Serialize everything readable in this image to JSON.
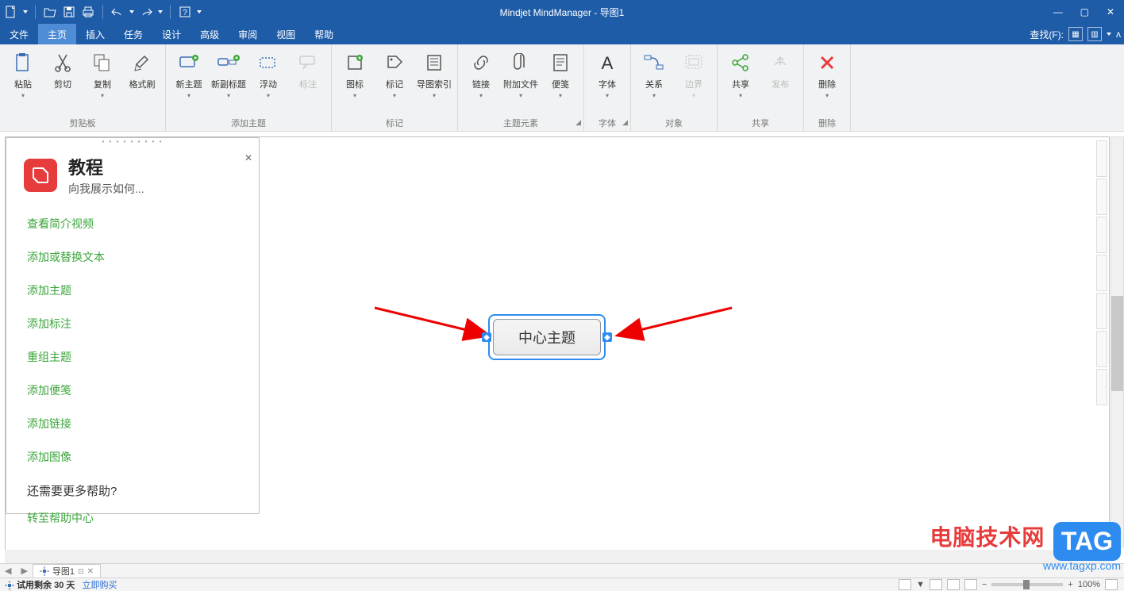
{
  "app": {
    "title": "Mindjet MindManager - 导图1"
  },
  "qat_icons": [
    "new",
    "open",
    "save",
    "print",
    "undo",
    "redo",
    "help"
  ],
  "menu": {
    "tabs": [
      "文件",
      "主页",
      "插入",
      "任务",
      "设计",
      "高级",
      "审阅",
      "视图",
      "帮助"
    ],
    "active": 1,
    "find_label": "查找(F):"
  },
  "ribbon": {
    "groups": [
      {
        "name": "剪贴板",
        "items": [
          {
            "id": "paste",
            "label": "粘贴",
            "dd": true
          },
          {
            "id": "cut",
            "label": "剪切"
          },
          {
            "id": "copy",
            "label": "复制",
            "dd": true
          },
          {
            "id": "format",
            "label": "格式刷"
          }
        ]
      },
      {
        "name": "添加主题",
        "items": [
          {
            "id": "new-topic",
            "label": "新主题",
            "dd": true
          },
          {
            "id": "new-subtopic",
            "label": "新副标题",
            "dd": true
          },
          {
            "id": "float",
            "label": "浮动",
            "dd": true
          },
          {
            "id": "callout",
            "label": "标注",
            "disabled": true
          }
        ]
      },
      {
        "name": "标记",
        "items": [
          {
            "id": "icon",
            "label": "图标",
            "dd": true
          },
          {
            "id": "tag",
            "label": "标记",
            "dd": true
          },
          {
            "id": "index",
            "label": "导图索引",
            "dd": true
          }
        ]
      },
      {
        "name": "主题元素",
        "launcher": true,
        "items": [
          {
            "id": "link",
            "label": "链接",
            "dd": true
          },
          {
            "id": "attach",
            "label": "附加文件",
            "dd": true
          },
          {
            "id": "note",
            "label": "便笺",
            "dd": true
          }
        ]
      },
      {
        "name": "字体",
        "launcher": true,
        "items": [
          {
            "id": "font",
            "label": "字体",
            "dd": true
          }
        ]
      },
      {
        "name": "对象",
        "items": [
          {
            "id": "relation",
            "label": "关系",
            "dd": true
          },
          {
            "id": "border",
            "label": "边界",
            "disabled": true,
            "dd": true
          }
        ]
      },
      {
        "name": "共享",
        "items": [
          {
            "id": "share",
            "label": "共享",
            "dd": true
          },
          {
            "id": "publish",
            "label": "发布",
            "disabled": true
          }
        ]
      },
      {
        "name": "删除",
        "items": [
          {
            "id": "delete",
            "label": "删除",
            "dd": true
          }
        ]
      }
    ]
  },
  "tutorial": {
    "title": "教程",
    "subtitle": "向我展示如何...",
    "links": [
      "查看简介视频",
      "添加或替换文本",
      "添加主题",
      "添加标注",
      "重组主题",
      "添加便笺",
      "添加链接",
      "添加图像"
    ],
    "more_q": "还需要更多帮助?",
    "help_center": "转至帮助中心"
  },
  "canvas": {
    "central_topic": "中心主题"
  },
  "doctab": {
    "name": "导图1"
  },
  "status": {
    "trial": "试用剩余 30 天",
    "buy": "立即购买",
    "zoom": "100%"
  },
  "watermark": {
    "line1": "电脑技术网",
    "line2": "www.tagxp.com",
    "tag": "TAG"
  }
}
